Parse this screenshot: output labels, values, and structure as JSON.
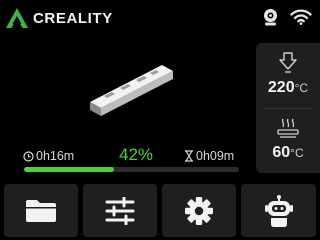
{
  "header": {
    "brand": "CREALITY",
    "logo_icon": "creality-logo-icon",
    "camera_icon": "camera-icon",
    "wifi_icon": "wifi-icon"
  },
  "print": {
    "elapsed": "0h16m",
    "percent_label": "42%",
    "progress_fraction": 0.42,
    "remaining": "0h09m"
  },
  "temps": {
    "nozzle": {
      "icon": "nozzle-icon",
      "value": "220",
      "unit": "°C"
    },
    "bed": {
      "icon": "heated-bed-icon",
      "value": "60",
      "unit": "°C"
    }
  },
  "buttons": [
    {
      "icon": "folder-icon"
    },
    {
      "icon": "sliders-icon"
    },
    {
      "icon": "gear-icon"
    },
    {
      "icon": "robot-icon"
    }
  ],
  "colors": {
    "accent_green": "#4dd03a",
    "panel_bg": "#1f1f1f",
    "background": "#000000"
  }
}
